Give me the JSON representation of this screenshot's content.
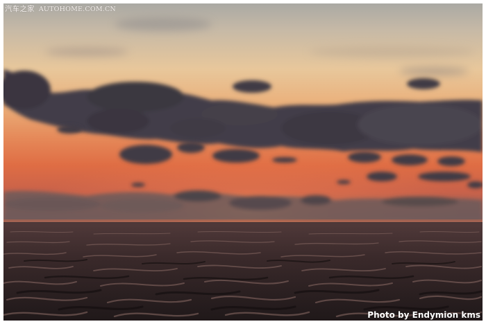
{
  "watermark": {
    "brand": "汽车之家",
    "site": "AUTOHOME.COM.CN"
  },
  "credit": {
    "text": "Photo by Endymion kms"
  },
  "colors": {
    "frame": "#ffffff",
    "sky_top": "#b9b3ab",
    "sky_glow": "#e9a76e",
    "horizon": "#e06a3e",
    "cloud": "#3f3b45",
    "sea": "#241b1c"
  }
}
